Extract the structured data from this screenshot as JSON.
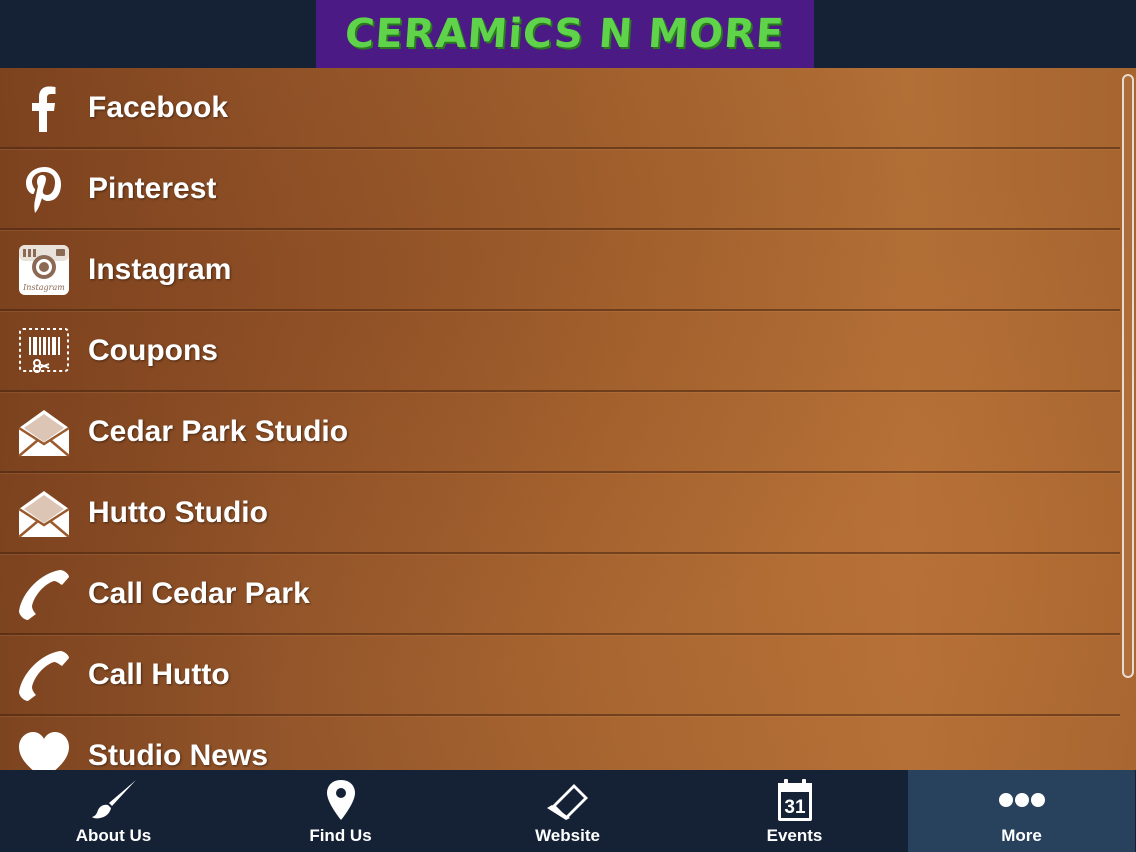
{
  "header": {
    "logo_text": "CERAMiCS N MORE"
  },
  "menu": {
    "items": [
      {
        "label": "Facebook",
        "icon": "facebook-icon"
      },
      {
        "label": "Pinterest",
        "icon": "pinterest-icon"
      },
      {
        "label": "Instagram",
        "icon": "instagram-icon"
      },
      {
        "label": "Coupons",
        "icon": "coupon-icon"
      },
      {
        "label": "Cedar Park Studio",
        "icon": "envelope-icon"
      },
      {
        "label": "Hutto Studio",
        "icon": "envelope-icon"
      },
      {
        "label": "Call Cedar Park",
        "icon": "phone-icon"
      },
      {
        "label": "Call Hutto",
        "icon": "phone-icon"
      },
      {
        "label": "Studio News",
        "icon": "heart-icon"
      }
    ]
  },
  "tabs": [
    {
      "label": "About Us",
      "icon": "paintbrush-icon"
    },
    {
      "label": "Find Us",
      "icon": "map-pin-icon"
    },
    {
      "label": "Website",
      "icon": "laptop-icon"
    },
    {
      "label": "Events",
      "icon": "calendar-icon",
      "calendar_day": "31"
    },
    {
      "label": "More",
      "icon": "more-dots-icon",
      "active": true
    }
  ],
  "colors": {
    "header_bg": "#152235",
    "logo_bg": "#4c1a84",
    "logo_text": "#5fd34a",
    "active_tab_bg": "#28425e"
  }
}
